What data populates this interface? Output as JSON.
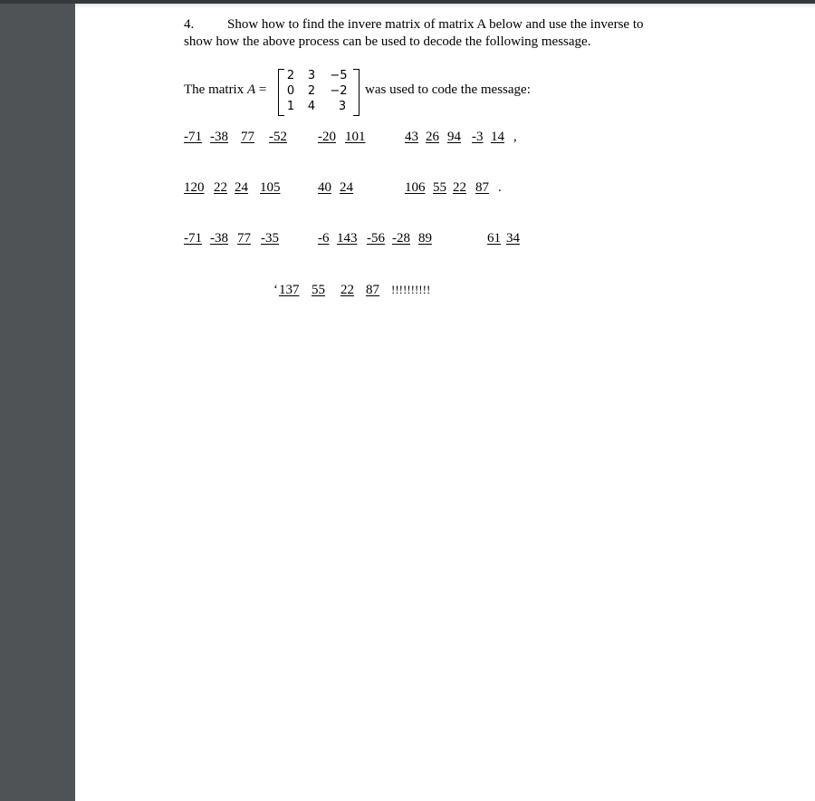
{
  "question": {
    "number": "4.",
    "line1": "Show how to find the invere matrix of matrix A below and use the inverse to",
    "line2": "show how the above process can be used to decode the following message."
  },
  "matrix_statement": {
    "prefix": "The matrix ",
    "variable": "A",
    "equals": " =",
    "suffix": "was used to code the message:",
    "matrix": [
      [
        "2",
        "3",
        "−5"
      ],
      [
        "0",
        "2",
        "−2"
      ],
      [
        "1",
        "4",
        "3"
      ]
    ]
  },
  "message": {
    "rows": [
      {
        "groups": [
          [
            "-71",
            "-38",
            "77",
            "-52"
          ],
          [
            "-20",
            "101"
          ],
          [
            "43",
            "26",
            "94",
            "-3",
            "14"
          ]
        ],
        "end_punct": ","
      },
      {
        "groups": [
          [
            "120",
            "22",
            "24",
            "105"
          ],
          [
            "40",
            "24"
          ],
          [
            "106",
            "55",
            "22",
            "87"
          ]
        ],
        "end_punct": "."
      },
      {
        "groups": [
          [
            "-71",
            "-38",
            "77",
            "-35"
          ],
          [
            "-6",
            "143",
            "-56",
            "-28",
            "89"
          ],
          [
            "61",
            "34"
          ]
        ],
        "end_punct": ""
      }
    ],
    "last_line": {
      "leading_mark": "‘",
      "numbers": [
        "137",
        "55",
        "22",
        "87"
      ],
      "trailing": "!!!!!!!!!!"
    }
  }
}
